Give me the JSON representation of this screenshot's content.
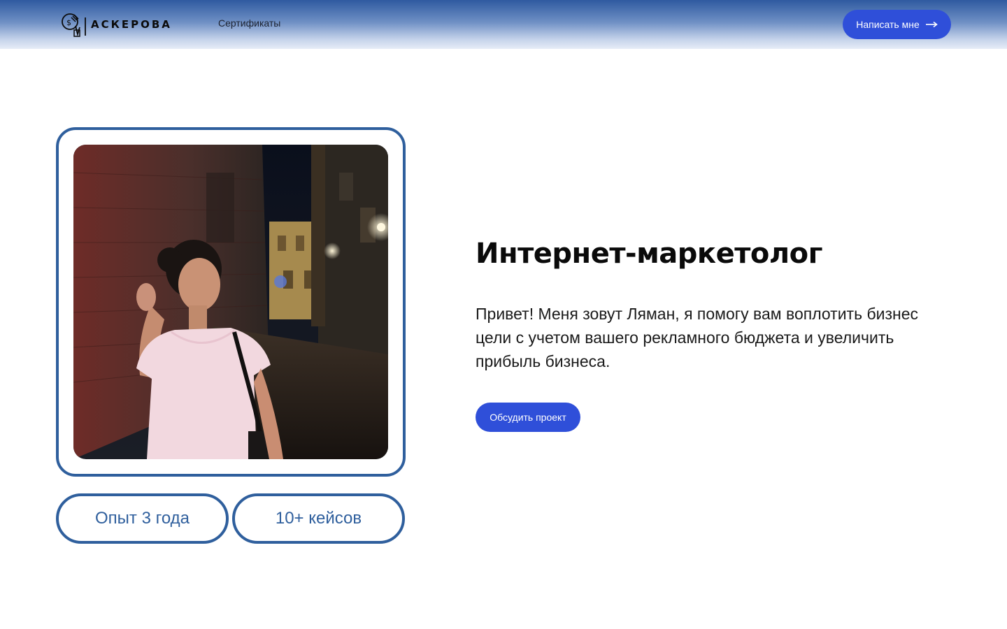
{
  "header": {
    "logo_text": "АСКЕРОВА",
    "nav": [
      {
        "label": "Сертификаты"
      }
    ],
    "contact_button": "Написать мне"
  },
  "hero": {
    "title": "Интернет-маркетолог",
    "description": "Привет! Меня зовут Ляман, я помогу вам воплотить бизнес цели с учетом вашего рекламного бюджета и увеличить прибыль бизнеса.",
    "cta_button": "Обсудить проект"
  },
  "stats": [
    {
      "label": "Опыт 3 года"
    },
    {
      "label": "10+ кейсов"
    }
  ],
  "colors": {
    "accent": "#2f4fd9",
    "frame": "#2f5f9d",
    "header_top": "#2f5aa0"
  },
  "icons": [
    "logo-mark-icon",
    "arrow-right-icon"
  ]
}
